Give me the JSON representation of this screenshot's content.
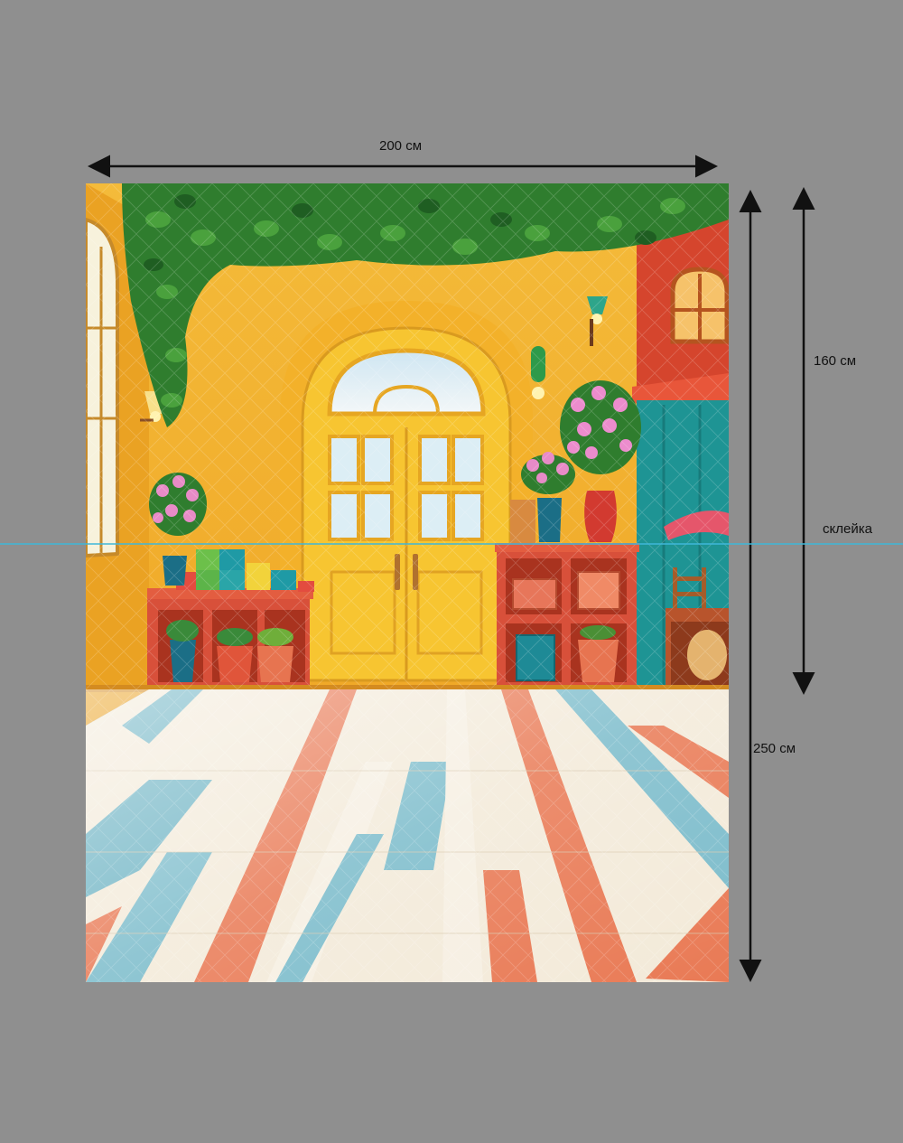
{
  "dimensions": {
    "width_label": "200 см",
    "panel_height_label": "160 см",
    "total_height_label": "250 см",
    "seam_label": "склейка"
  },
  "colors": {
    "background": "#8f8f8f",
    "arrow": "#111111",
    "seam_line": "#3fb7d9",
    "wall": "#f2b531",
    "door": "#f7c531",
    "shelf": "#d8503a",
    "teal": "#1e9494",
    "leaves": "#2f7d2e"
  },
  "icons": [
    "vine-leaves-icon",
    "wall-lamp-icon",
    "flower-pot-icon",
    "toy-blocks-icon",
    "storage-box-icon",
    "chair-icon",
    "arched-window-icon"
  ]
}
